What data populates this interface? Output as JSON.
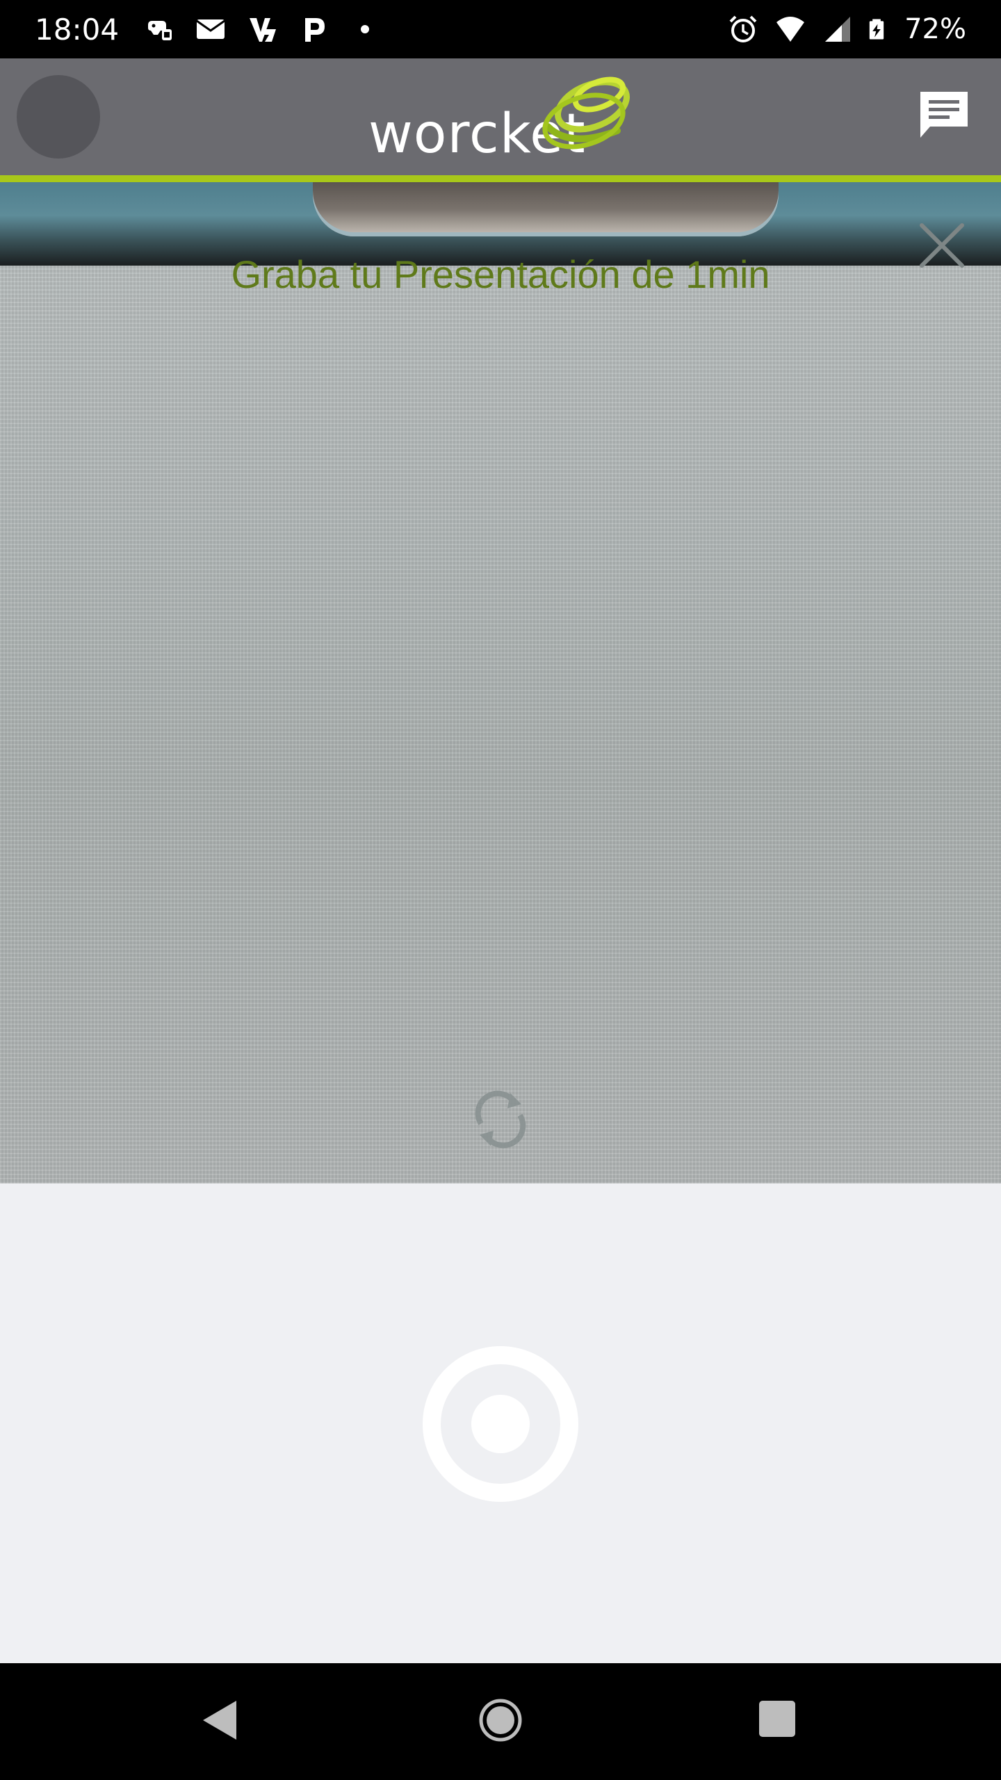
{
  "status_bar": {
    "time": "18:04",
    "battery": "72%",
    "left_icons": [
      "game-controller-icon",
      "mail-icon",
      "vpn-icon",
      "p-app-icon",
      "dot-icon"
    ],
    "right_icons": [
      "alarm-icon",
      "wifi-icon",
      "signal-icon",
      "battery-charging-icon"
    ]
  },
  "header": {
    "logo_text": "worcket",
    "accent_color": "#a8c81a",
    "background_color": "#6b6b70"
  },
  "camera": {
    "title": "Graba tu Presentación de 1min",
    "title_color": "#5f7a1a"
  },
  "controls": {
    "record_icon": "record-icon"
  },
  "nav": {
    "back": "back-icon",
    "home": "home-icon",
    "recents": "recents-icon"
  }
}
